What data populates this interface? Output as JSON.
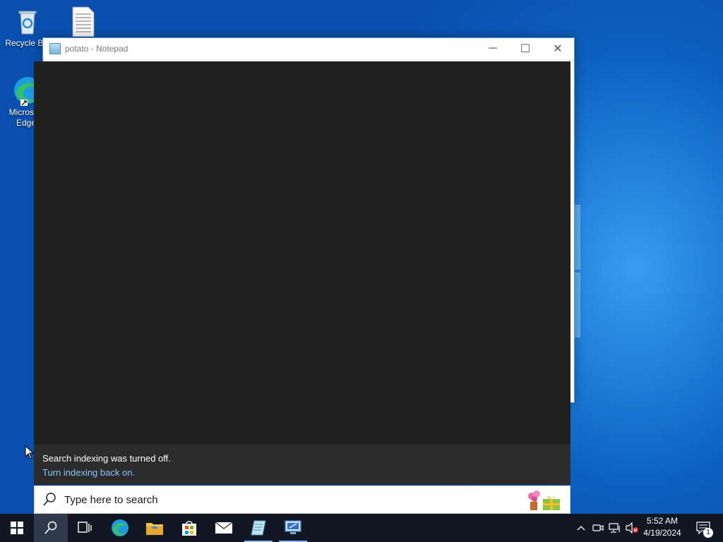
{
  "desktop": {
    "icons": [
      {
        "label": "Recycle Bin",
        "icon": "recycle-bin-icon"
      },
      {
        "label": "",
        "icon": "text-file-icon"
      },
      {
        "label": "Microsoft Edge",
        "icon": "edge-icon"
      }
    ]
  },
  "notepad": {
    "title": "potato - Notepad",
    "controls": {
      "minimize": "─",
      "maximize": "☐",
      "close": "✕"
    }
  },
  "search_panel": {
    "notice_title": "Search indexing was turned off.",
    "notice_link": "Turn indexing back on.",
    "search_placeholder": "Type here to search",
    "search_value": ""
  },
  "taskbar": {
    "buttons": [
      "start-icon",
      "search-icon",
      "task-view-icon",
      "edge-icon",
      "file-explorer-icon",
      "store-icon",
      "mail-icon",
      "notepad-icon",
      "remote-desktop-icon"
    ],
    "clock_time": "5:52 AM",
    "clock_date": "4/19/2024",
    "notification_count": "1"
  },
  "colors": {
    "accent": "#0a5fc0",
    "link": "#8cc3ff",
    "taskbar": "#111823",
    "flyout": "#202020"
  }
}
